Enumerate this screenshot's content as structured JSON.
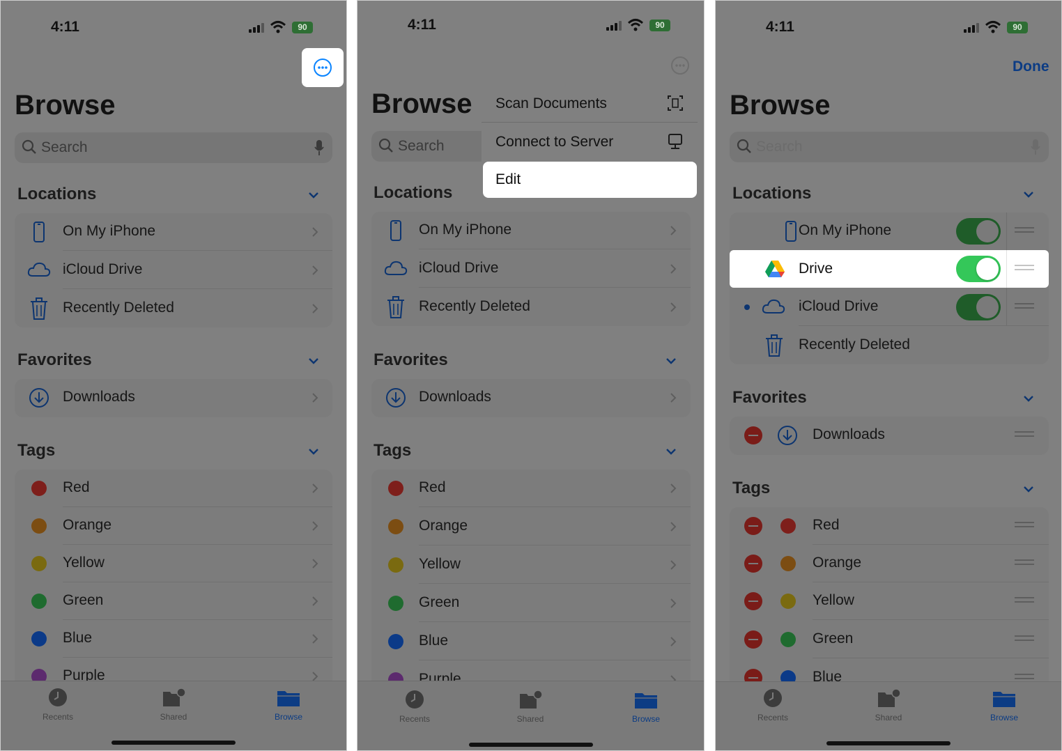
{
  "status": {
    "time": "4:11",
    "battery": "90"
  },
  "common": {
    "title": "Browse",
    "search_placeholder": "Search",
    "locations_header": "Locations",
    "favorites_header": "Favorites",
    "tags_header": "Tags",
    "on_my_iphone": "On My iPhone",
    "icloud_drive": "iCloud Drive",
    "recently_deleted": "Recently Deleted",
    "downloads": "Downloads",
    "tags": [
      "Red",
      "Orange",
      "Yellow",
      "Green",
      "Blue",
      "Purple"
    ],
    "tag_colors": [
      "#7e1f1b",
      "#7c4d12",
      "#7a6a10",
      "#1f6b2f",
      "#0b3a88",
      "#5c2a6e"
    ]
  },
  "menu": {
    "scan": "Scan Documents",
    "connect": "Connect to Server",
    "edit": "Edit"
  },
  "edit_screen": {
    "done": "Done",
    "drive": "Drive"
  },
  "tabbar": {
    "recents": "Recents",
    "shared": "Shared",
    "browse": "Browse"
  },
  "colors": {
    "accent": "#0a84ff",
    "toggle_on": "#34c759",
    "overlay": "#808080"
  }
}
